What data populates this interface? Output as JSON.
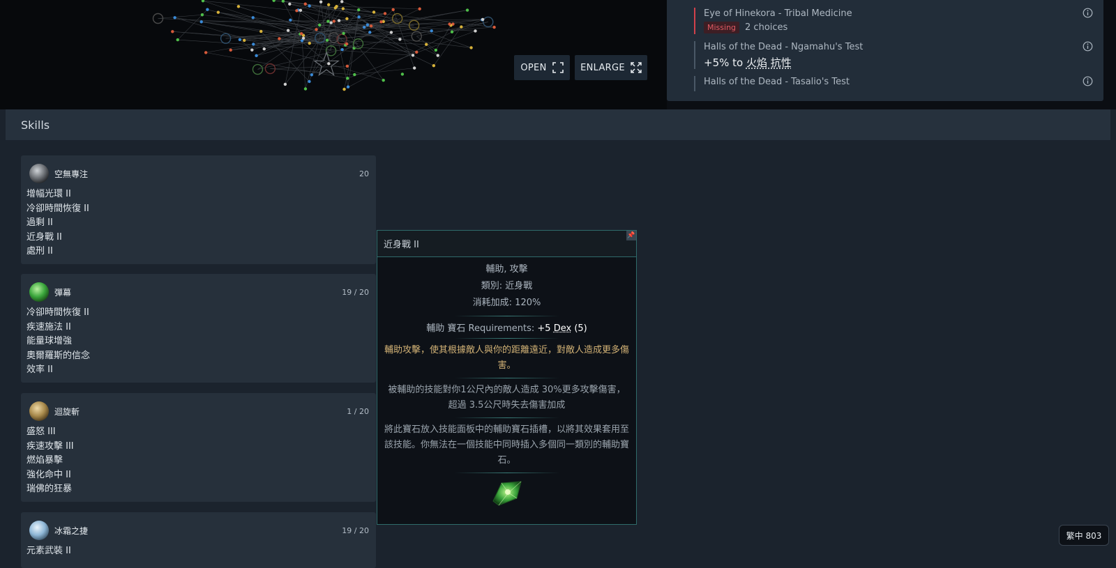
{
  "tree": {
    "open_label": "OPEN",
    "enlarge_label": "ENLARGE"
  },
  "quests": [
    {
      "title": "Eye of Hinekora - Tribal Medicine",
      "status": "Missing",
      "detail": "2 choices"
    },
    {
      "title": "Halls of the Dead - Ngamahu's Test",
      "reward_prefix": "+5% to ",
      "reward_stat": "火焰 抗性"
    },
    {
      "title": "Halls of the Dead - Tasalio's Test"
    }
  ],
  "skills": {
    "header": "Skills",
    "cards": [
      {
        "name": "空無專注",
        "level": "20",
        "gem_color": "#6b6f74",
        "supports": [
          "增幅光環 II",
          "冷卻時間恢復 II",
          "過剩 II",
          "近身戰 II",
          "處刑 II"
        ]
      },
      {
        "name": "彈幕",
        "level": "19 / 20",
        "gem_color": "#3aa63c",
        "supports": [
          "冷卻時間恢復 II",
          "疾速施法 II",
          "能量球增強",
          "奧爾羅斯的信念",
          "效率 II"
        ]
      },
      {
        "name": "迴旋斬",
        "level": "1 / 20",
        "gem_color": "#a88a4c",
        "supports": [
          "盛怒 III",
          "疾速攻擊 III",
          "燃焰暴擊",
          "強化命中 II",
          "瑞佛的狂暴"
        ]
      },
      {
        "name": "冰霜之捷",
        "level": "19 / 20",
        "gem_color": "#8fb7d6",
        "supports": [
          "元素武裝 II"
        ]
      }
    ]
  },
  "tooltip": {
    "title": "近身戰 II",
    "pin": "📌",
    "tags": "輔助, 攻擊",
    "category": "類別: 近身戰",
    "cost": "消耗加成: 120%",
    "req_prefix": "輔助 寶石 Requirements: ",
    "req_value": "+5 ",
    "req_stat": "Dex",
    "req_suffix": " (5)",
    "desc_gold": "輔助攻擊，使其根據敵人與你的距離遠近，對敵人造成更多傷害。",
    "desc_effect": "被輔助的技能對你1公尺內的敵人造成 30%更多攻擊傷害，超過 3.5公尺時失去傷害加成",
    "desc_help": "將此寶石放入技能面板中的輔助寶石插槽，以將其效果套用至該技能。你無法在一個技能中同時插入多個同一類別的輔助寶石。"
  },
  "lang_badge": "繁中 803",
  "colors": {
    "accent_teal": "#2f6b6b",
    "missing_red": "#d2414b",
    "gold_text": "#d1b175"
  }
}
